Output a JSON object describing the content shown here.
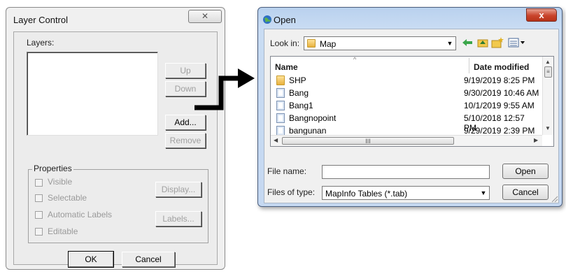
{
  "layer_control": {
    "title": "Layer Control",
    "close_glyph": "✕",
    "layers_label": "Layers:",
    "buttons": {
      "up": "Up",
      "down": "Down",
      "add": "Add...",
      "remove": "Remove"
    },
    "properties": {
      "legend": "Properties",
      "checkboxes": [
        "Visible",
        "Selectable",
        "Automatic Labels",
        "Editable"
      ],
      "display_button": "Display...",
      "labels_button": "Labels..."
    },
    "ok": "OK",
    "cancel": "Cancel"
  },
  "open_dialog": {
    "title": "Open",
    "close_glyph": "x",
    "look_in_label": "Look in:",
    "look_in_value": "Map",
    "columns": {
      "name": "Name",
      "date_modified": "Date modified"
    },
    "files": [
      {
        "name": "SHP",
        "date": "9/19/2019 8:25 PM",
        "icon": "folder-icon"
      },
      {
        "name": "Bang",
        "date": "9/30/2019 10:46 AM",
        "icon": "file-icon"
      },
      {
        "name": "Bang1",
        "date": "10/1/2019 9:55 AM",
        "icon": "file-icon"
      },
      {
        "name": "Bangnopoint",
        "date": "5/10/2018 12:57 PM",
        "icon": "file-icon"
      },
      {
        "name": "bangunan",
        "date": "9/29/2019 2:39 PM",
        "icon": "file-icon"
      }
    ],
    "hscroll_grip": "III",
    "file_name_label": "File name:",
    "file_name_value": "",
    "files_of_type_label": "Files of type:",
    "files_of_type_value": "MapInfo Tables (*.tab)",
    "open_button": "Open",
    "cancel_button": "Cancel"
  },
  "colors": {
    "title_bar": "#c5d8f1",
    "close_red": "#c9442c",
    "dialog_bg": "#f0f0f0"
  }
}
